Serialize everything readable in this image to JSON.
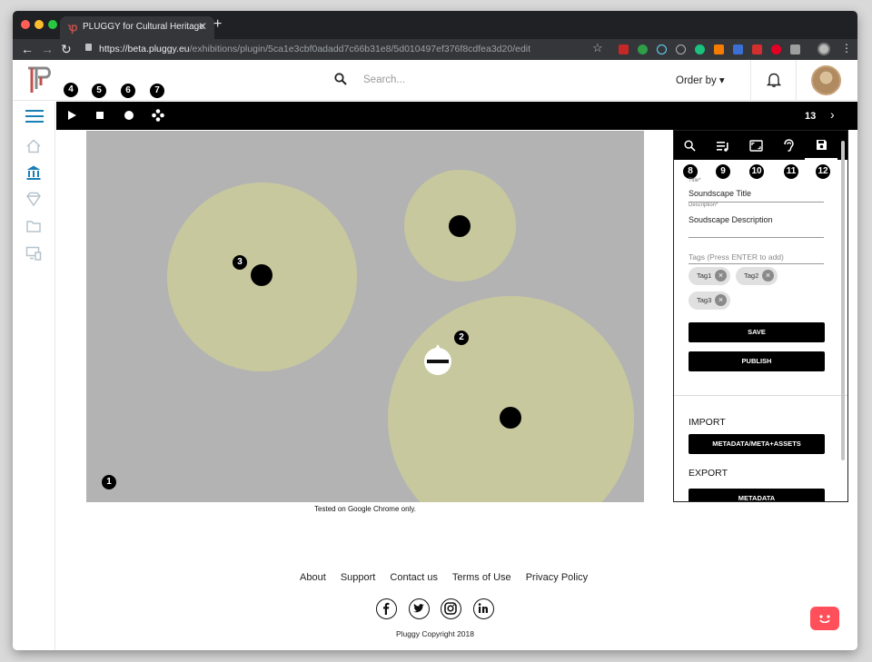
{
  "browser": {
    "tab_title": "PLUGGY for Cultural Heritage",
    "tab_close": "✕",
    "new_tab": "+",
    "url_host": "https://beta.pluggy.eu",
    "url_path": "/exhibitions/plugin/5ca1e3cbf0adadd7c66b31e8/5d010497ef376f8cdfea3d20/edit"
  },
  "header": {
    "search_placeholder": "Search...",
    "order_by": "Order by ▾"
  },
  "steps": [
    "1",
    "2",
    "3",
    "4",
    "5",
    "6",
    "7",
    "8",
    "9",
    "10",
    "11",
    "12"
  ],
  "player": {
    "count": "13",
    "next": "›"
  },
  "canvas": {
    "note": "Tested on Google Chrome only."
  },
  "panel": {
    "title_label": "Title*",
    "title_value": "Soundscape Title",
    "description_label": "Description*",
    "description_value": "Soudscape Description",
    "tags_placeholder": "Tags (Press ENTER to add)",
    "tags": [
      "Tag1",
      "Tag2",
      "Tag3"
    ],
    "save": "SAVE",
    "publish": "PUBLISH",
    "import_heading": "IMPORT",
    "import_button": "METADATA/META+ASSETS",
    "export_heading": "EXPORT",
    "export_button": "METADATA"
  },
  "footer": {
    "links": [
      "About",
      "Support",
      "Contact us",
      "Terms of Use",
      "Privacy Policy"
    ],
    "copyright": "Pluggy Copyright 2018"
  },
  "colors": {
    "accent": "#1a7fb5",
    "zone": "#c8c89e",
    "canvas": "#b3b3b3",
    "chat": "#ff4f5a"
  }
}
